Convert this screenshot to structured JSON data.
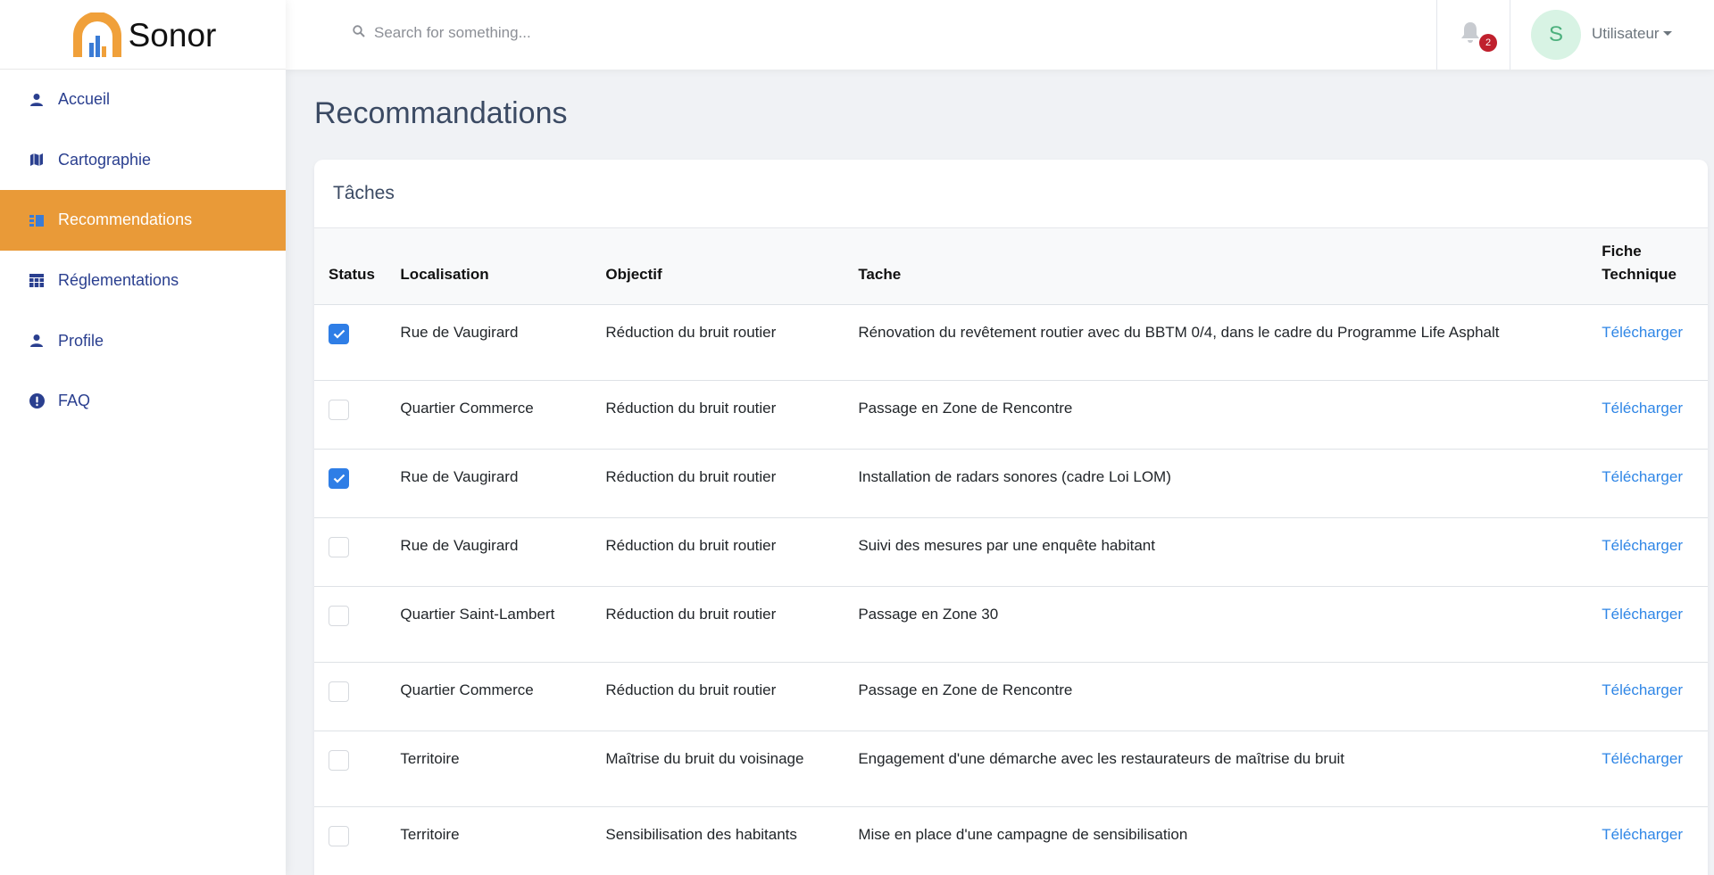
{
  "brand": {
    "name": "Sonor"
  },
  "sidebar": {
    "items": [
      {
        "label": "Accueil",
        "icon": "person-icon",
        "active": false
      },
      {
        "label": "Cartographie",
        "icon": "map-icon",
        "active": false
      },
      {
        "label": "Recommendations",
        "icon": "list-icon",
        "active": true
      },
      {
        "label": "Réglementations",
        "icon": "table-icon",
        "active": false
      },
      {
        "label": "Profile",
        "icon": "person-icon",
        "active": false
      },
      {
        "label": "FAQ",
        "icon": "exclamation-icon",
        "active": false
      }
    ]
  },
  "topbar": {
    "search_placeholder": "Search for something...",
    "notification_count": "2",
    "avatar_initial": "S",
    "user_label": "Utilisateur"
  },
  "page": {
    "title": "Recommandations"
  },
  "card": {
    "title": "Tâches",
    "columns": {
      "status": "Status",
      "localisation": "Localisation",
      "objectif": "Objectif",
      "tache": "Tache",
      "fiche": "Fiche Technique"
    },
    "rows": [
      {
        "checked": true,
        "localisation": "Rue de Vaugirard",
        "objectif": "Réduction du bruit routier",
        "tache": "Rénovation du revêtement routier avec du BBTM 0/4, dans le cadre du Programme Life Asphalt",
        "fiche": "Télécharger"
      },
      {
        "checked": false,
        "localisation": "Quartier Commerce",
        "objectif": "Réduction du bruit routier",
        "tache": "Passage en Zone de Rencontre",
        "fiche": "Télécharger"
      },
      {
        "checked": true,
        "localisation": "Rue de Vaugirard",
        "objectif": "Réduction du bruit routier",
        "tache": "Installation de radars sonores (cadre Loi LOM)",
        "fiche": "Télécharger"
      },
      {
        "checked": false,
        "localisation": "Rue de Vaugirard",
        "objectif": "Réduction du bruit routier",
        "tache": "Suivi des mesures par une enquête habitant",
        "fiche": "Télécharger"
      },
      {
        "checked": false,
        "localisation": "Quartier Saint-Lambert",
        "objectif": "Réduction du bruit routier",
        "tache": "Passage en Zone 30",
        "fiche": "Télécharger"
      },
      {
        "checked": false,
        "localisation": "Quartier Commerce",
        "objectif": "Réduction du bruit routier",
        "tache": "Passage en Zone de Rencontre",
        "fiche": "Télécharger"
      },
      {
        "checked": false,
        "localisation": "Territoire",
        "objectif": "Maîtrise du bruit du voisinage",
        "tache": "Engagement d'une démarche avec les restaurateurs de maîtrise du bruit",
        "fiche": "Télécharger"
      },
      {
        "checked": false,
        "localisation": "Territoire",
        "objectif": "Sensibilisation des habitants",
        "tache": "Mise en place d'une campagne de sensibilisation",
        "fiche": "Télécharger"
      }
    ]
  },
  "colors": {
    "accent": "#e99a38",
    "nav_text": "#2a3f8f",
    "link": "#2f86e6",
    "checkbox": "#2f7ee6",
    "badge": "#c0202d"
  }
}
